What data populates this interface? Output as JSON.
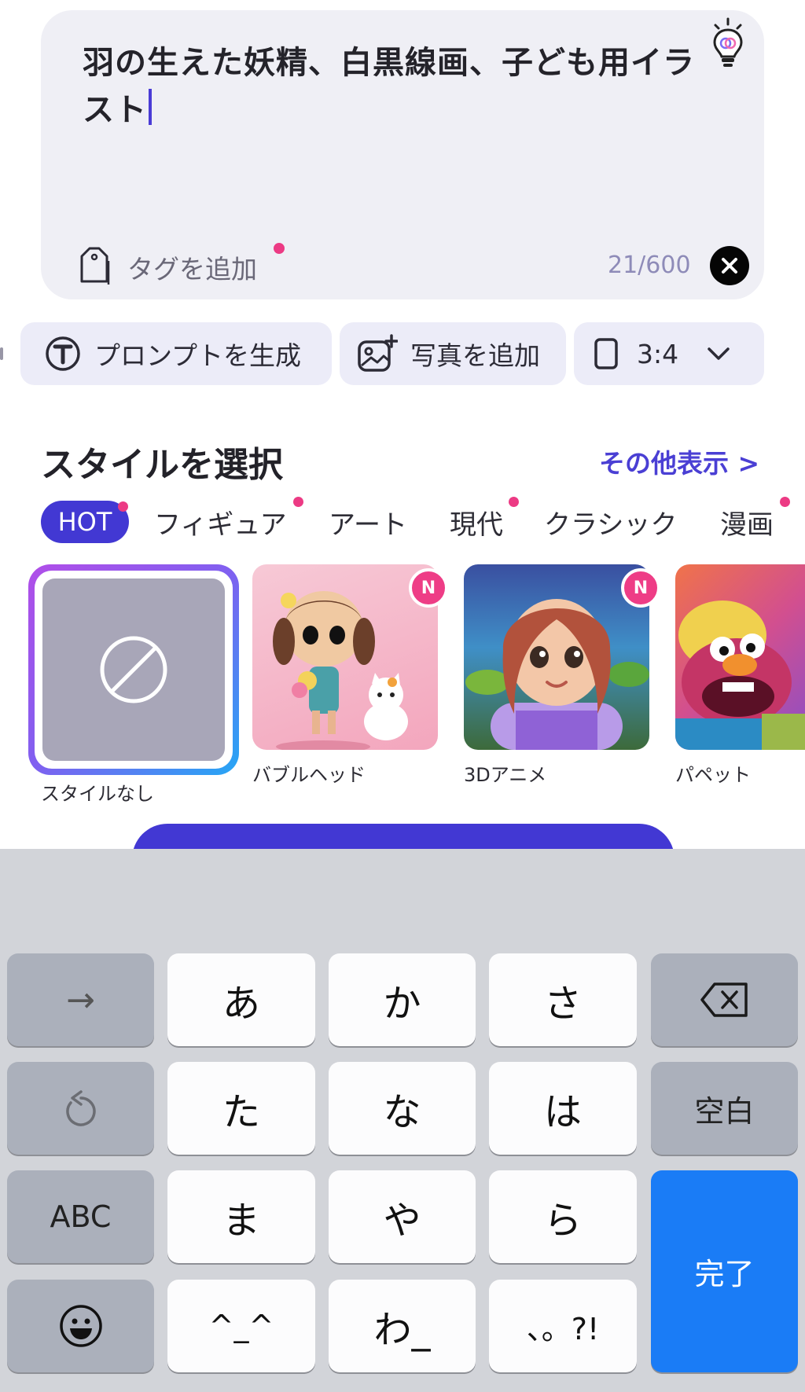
{
  "prompt": {
    "text": "羽の生えた妖精、白黒線画、子ども用イラスト",
    "tag_label": "タグを追加",
    "counter": "21/600",
    "bulb_icon": "lightbulb-icon",
    "clear_icon": "close-icon"
  },
  "actions": {
    "generate_prompt": "プロンプトを生成",
    "add_photo": "写真を追加",
    "aspect_ratio": "3:4"
  },
  "styles": {
    "title": "スタイルを選択",
    "more": "その他表示 >",
    "categories": [
      "HOT",
      "フィギュア",
      "アート",
      "現代",
      "クラシック",
      "漫画"
    ],
    "items": [
      {
        "name": "スタイルなし",
        "selected": true
      },
      {
        "name": "バブルヘッド",
        "badge": "N"
      },
      {
        "name": "3Dアニメ",
        "badge": "N"
      },
      {
        "name": "パペット"
      }
    ]
  },
  "keyboard": {
    "keys": {
      "arrow": "→",
      "a": "あ",
      "ka": "か",
      "sa": "さ",
      "ta": "た",
      "na": "な",
      "ha": "は",
      "space": "空白",
      "abc": "ABC",
      "ma": "ま",
      "ya": "や",
      "ra": "ら",
      "done": "完了",
      "kaomoji": "^_^",
      "wa": "わ_",
      "punct": "、。?!"
    }
  },
  "colors": {
    "accent": "#4238d3",
    "badge": "#ee3d86",
    "done_key": "#1a7cf6"
  }
}
